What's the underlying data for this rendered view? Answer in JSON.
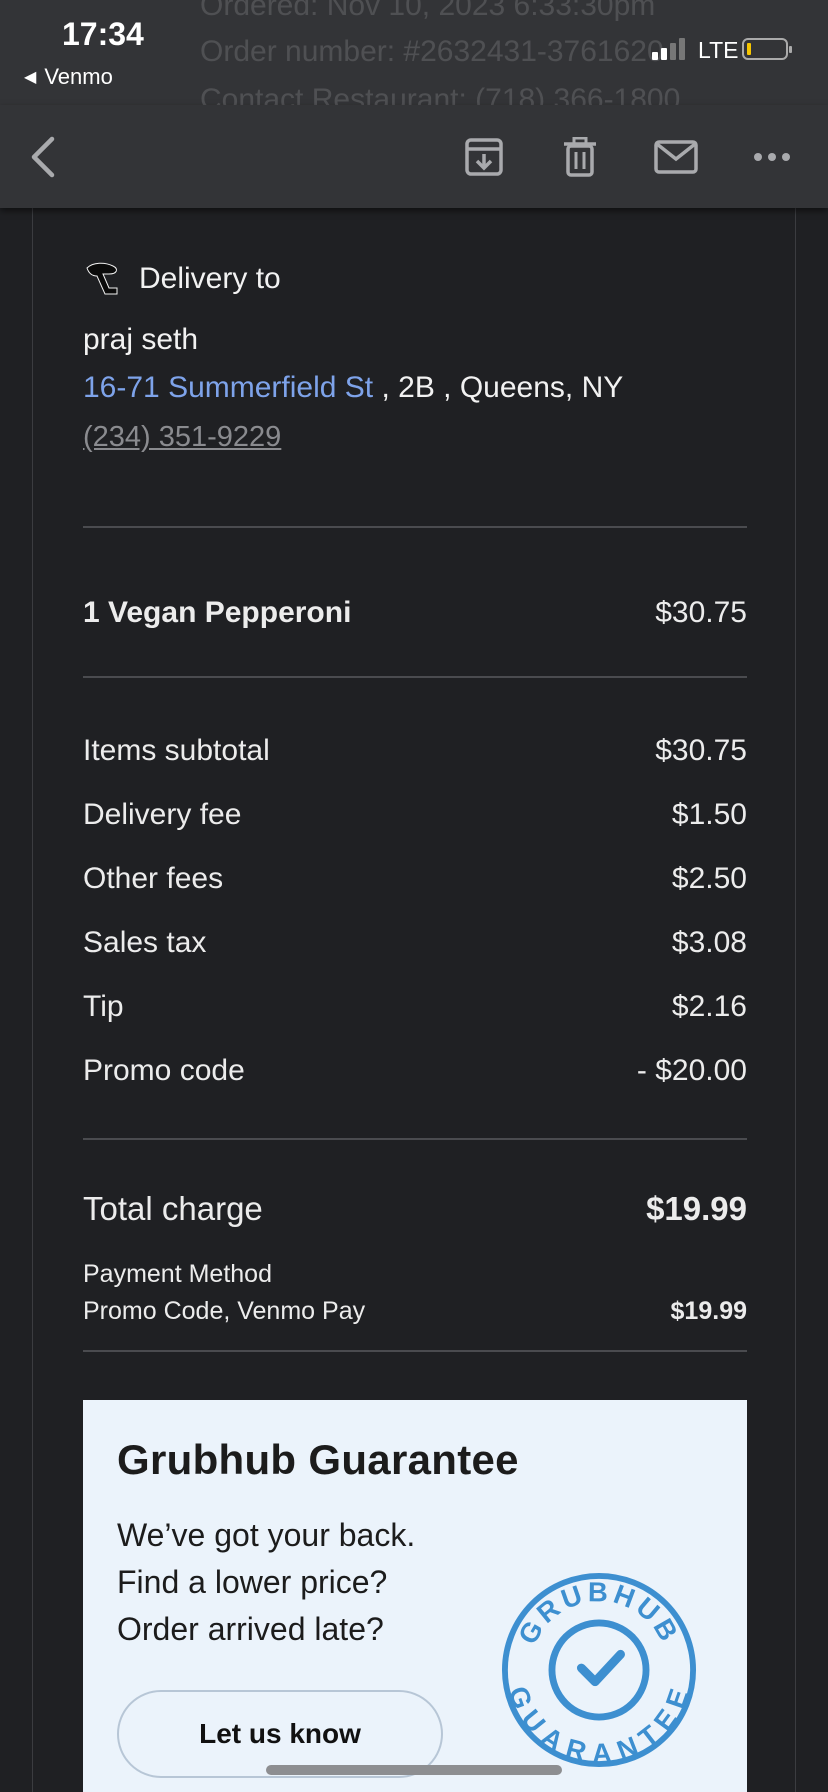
{
  "status_bar": {
    "time": "17:34",
    "back_app": "Venmo",
    "network": "LTE",
    "ghost_lines": [
      "Ordered: Nov 10, 2023 6:33:30pm",
      "Order number: #2632431-3761620",
      "Contact Restaurant: (718) 366-1800"
    ]
  },
  "toolbar": {
    "back_icon": "chevron-left-icon",
    "archive_icon": "archive-icon",
    "trash_icon": "trash-icon",
    "mail_icon": "envelope-icon",
    "more_icon": "more-icon"
  },
  "delivery": {
    "heading": "Delivery to",
    "name": "praj seth",
    "street": "16-71 Summerfield St",
    "rest_of_address": " , 2B , Queens, NY",
    "phone": "(234) 351-9229"
  },
  "items": [
    {
      "label": "1 Vegan Pepperoni",
      "amount": "$30.75"
    }
  ],
  "charges": [
    {
      "label": "Items subtotal",
      "amount": "$30.75"
    },
    {
      "label": "Delivery fee",
      "amount": "$1.50"
    },
    {
      "label": "Other fees",
      "amount": "$2.50"
    },
    {
      "label": "Sales tax",
      "amount": "$3.08"
    },
    {
      "label": "Tip",
      "amount": "$2.16"
    },
    {
      "label": "Promo code",
      "amount": "- $20.00"
    }
  ],
  "total": {
    "label": "Total charge",
    "amount": "$19.99"
  },
  "payment": {
    "label": "Payment Method",
    "method": "Promo Code, Venmo Pay",
    "amount": "$19.99"
  },
  "guarantee": {
    "title": "Grubhub Guarantee",
    "text": "We’ve got your back.\nFind a lower price?\nOrder arrived late?",
    "button": "Let us know",
    "seal_top": "GRUBHUB",
    "seal_bottom": "GUARANTEE"
  },
  "colors": {
    "background": "#1f2023",
    "toolbar": "#333437",
    "link": "#7ea3ea",
    "card": "#ebf3fb",
    "seal_blue": "#3d8fd0"
  }
}
